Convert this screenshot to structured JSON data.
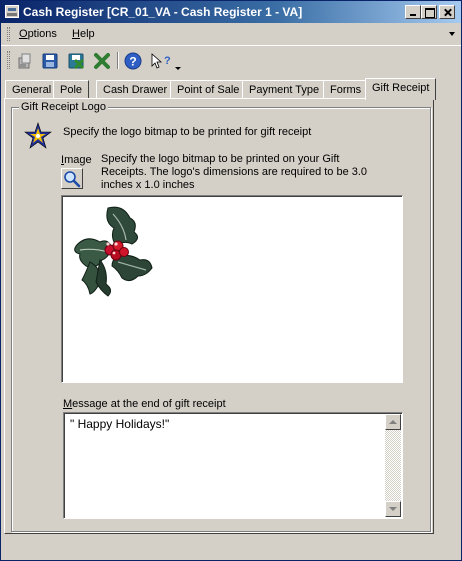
{
  "window": {
    "title": "Cash Register [CR_01_VA - Cash Register 1 - VA]"
  },
  "menu": {
    "items": [
      {
        "label_accel": "O",
        "label_rest": "ptions"
      },
      {
        "label_accel": "H",
        "label_rest": "elp"
      }
    ]
  },
  "toolbar": {
    "icons": [
      "new-record-icon",
      "save-icon",
      "delete-icon",
      "cancel-icon",
      "help-icon",
      "whats-this-help-icon"
    ]
  },
  "tabs": [
    {
      "label": "General",
      "active": false
    },
    {
      "label": "Pole",
      "active": false
    },
    {
      "label": "Cash Drawer",
      "active": false
    },
    {
      "label": "Point of Sale",
      "active": false
    },
    {
      "label": "Payment Type",
      "active": false
    },
    {
      "label": "Forms",
      "active": false
    },
    {
      "label": "Gift Receipt",
      "active": true
    }
  ],
  "gift_receipt": {
    "group_title": "Gift Receipt Logo",
    "logo_description": "Specify the logo bitmap to be printed for gift receipt",
    "image_label_accel": "I",
    "image_label_rest": "mage",
    "image_hint": "Specify the logo bitmap to be printed on your Gift Receipts. The logo's dimensions are required to be 3.0 inches x 1.0 inches",
    "message_label_accel": "M",
    "message_label_rest": "essage at the end of gift receipt",
    "message_value": "\" Happy Holidays!\""
  },
  "colors": {
    "window_bg": "#d4d0c8",
    "title_active": "#0a246a",
    "title_gradient_end": "#a6caf0"
  }
}
